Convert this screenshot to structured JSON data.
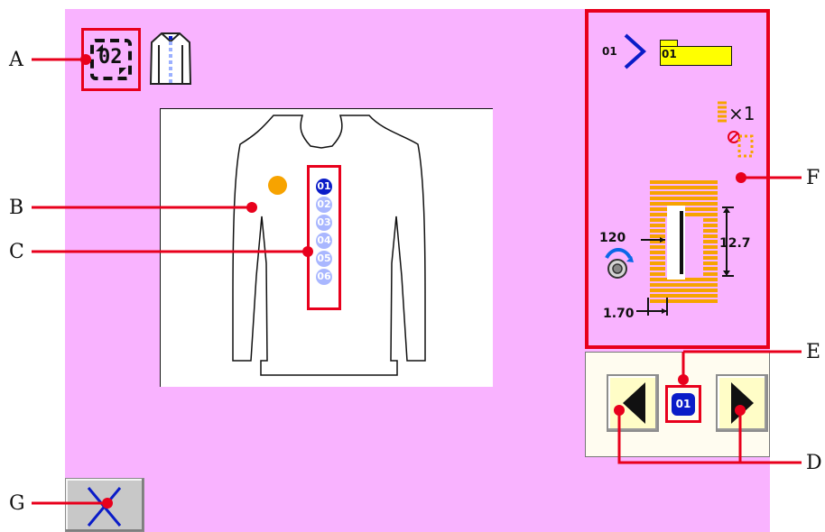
{
  "callouts": [
    "A",
    "B",
    "C",
    "D",
    "E",
    "F",
    "G"
  ],
  "header": {
    "pattern_number": "02"
  },
  "list": {
    "items": [
      "01",
      "02",
      "03",
      "04",
      "05",
      "06"
    ]
  },
  "panel": {
    "step_label": "01",
    "folder_label": "01",
    "multiplier": "×1",
    "speed": "120",
    "length": "12.7",
    "pitch": "1.70"
  },
  "navigation": {
    "current": "01"
  },
  "colors": {
    "screen_bg": "#f9b3ff",
    "callout_red": "#e8001c",
    "selected_blue": "#0a1cc8",
    "unselected_blue": "#a9b7ff",
    "orange": "#f7a300"
  }
}
